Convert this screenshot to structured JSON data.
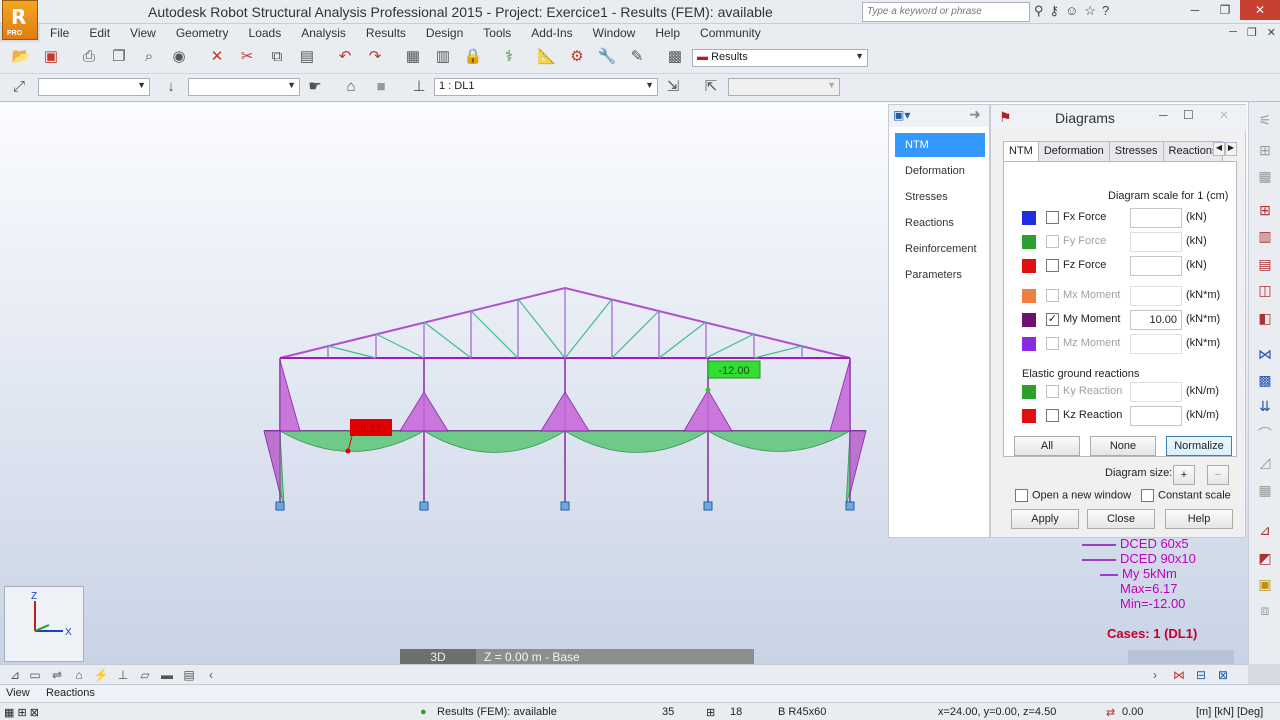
{
  "window": {
    "title": "Autodesk Robot Structural Analysis Professional 2015 - Project: Exercice1 - Results (FEM): available",
    "logo_text": "PRO",
    "search_placeholder": "Type a keyword or phrase"
  },
  "menu": [
    "File",
    "Edit",
    "View",
    "Geometry",
    "Loads",
    "Analysis",
    "Results",
    "Design",
    "Tools",
    "Add-Ins",
    "Window",
    "Help",
    "Community"
  ],
  "toolbar": {
    "layout_select": "Results",
    "case_select": "1 : DL1"
  },
  "diagram_labels": {
    "max_value": "6.17",
    "min_value": "-12.00"
  },
  "legend": {
    "lines": [
      "DCED 60x5",
      "DCED 90x10",
      "My  5kNm",
      "Max=6.17",
      "Min=-12.00"
    ],
    "cases": "Cases: 1 (DL1)"
  },
  "view_bar": {
    "mode": "3D",
    "plane": "Z = 0.00 m - Base"
  },
  "diagrams_panel": {
    "title": "Diagrams",
    "nav": [
      "NTM",
      "Deformation",
      "Stresses",
      "Reactions",
      "Reinforcement",
      "Parameters"
    ],
    "tabs": [
      "NTM",
      "Deformation",
      "Stresses",
      "Reactions"
    ],
    "scale_label": "Diagram scale for 1  (cm)",
    "rows": [
      {
        "color": "#1f2fe0",
        "label": "Fx Force",
        "value": "",
        "unit": "(kN)",
        "checked": false,
        "enabled": true
      },
      {
        "color": "#2ca02c",
        "label": "Fy Force",
        "value": "",
        "unit": "(kN)",
        "checked": false,
        "enabled": false
      },
      {
        "color": "#e01010",
        "label": "Fz Force",
        "value": "",
        "unit": "(kN)",
        "checked": false,
        "enabled": true
      },
      {
        "color": "#f08040",
        "label": "Mx Moment",
        "value": "",
        "unit": "(kN*m)",
        "checked": false,
        "enabled": false
      },
      {
        "color": "#6e1070",
        "label": "My Moment",
        "value": "10.00",
        "unit": "(kN*m)",
        "checked": true,
        "enabled": true
      },
      {
        "color": "#8a2be2",
        "label": "Mz Moment",
        "value": "",
        "unit": "(kN*m)",
        "checked": false,
        "enabled": false
      }
    ],
    "egr_label": "Elastic ground reactions",
    "egr_rows": [
      {
        "color": "#2ca02c",
        "label": "Ky Reaction",
        "value": "",
        "unit": "(kN/m)",
        "checked": false,
        "enabled": false
      },
      {
        "color": "#e01010",
        "label": "Kz Reaction",
        "value": "",
        "unit": "(kN/m)",
        "checked": false,
        "enabled": true
      }
    ],
    "sel_buttons": [
      "All",
      "None",
      "Normalize"
    ],
    "diagram_size_label": "Diagram size:",
    "size_plus": "+",
    "size_minus": "−",
    "open_new_window": "Open a new window",
    "constant_scale": "Constant scale",
    "apply": "Apply",
    "close": "Close",
    "help": "Help"
  },
  "view_tabs": [
    "View",
    "Reactions"
  ],
  "status": {
    "results": "Results (FEM): available",
    "num1": "35",
    "num2": "18",
    "section": "B R45x60",
    "coords": "x=24.00, y=0.00, z=4.50",
    "angle": "0.00",
    "units": "[m] [kN] [Deg]"
  }
}
